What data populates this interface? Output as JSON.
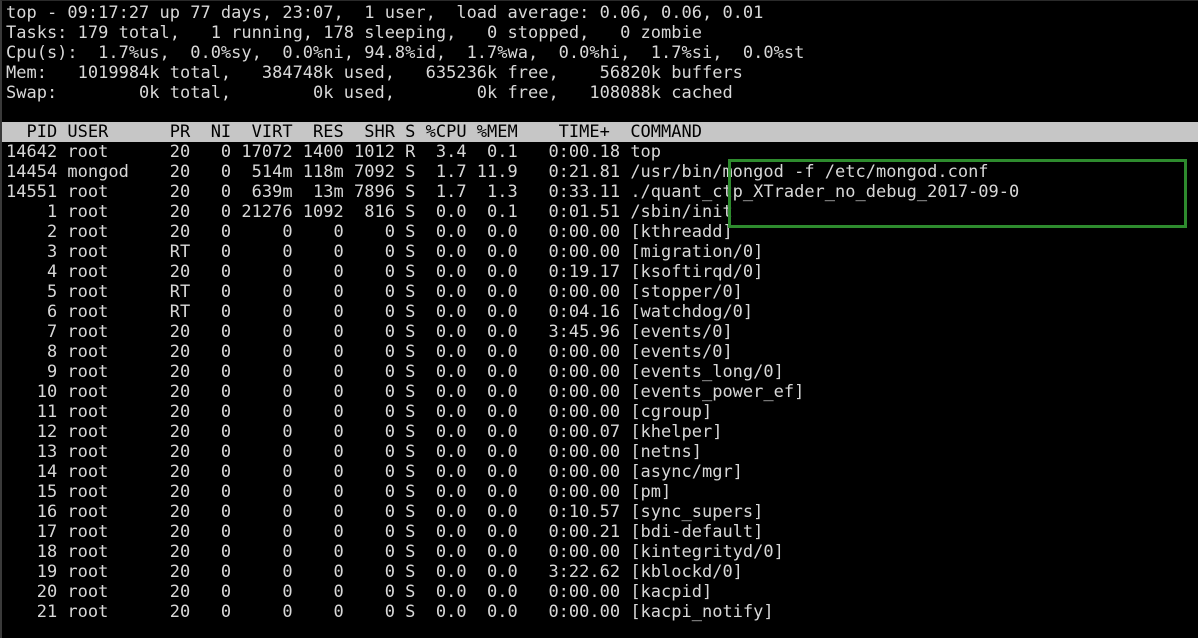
{
  "window": {
    "title": "top",
    "background": "#000000",
    "foreground": "#d8d8d8",
    "header_bg": "#c6c6c6",
    "header_fg": "#000000",
    "highlight_color": "#2e8b2e"
  },
  "summary": {
    "line1": "top - 09:17:27 up 77 days, 23:07,  1 user,  load average: 0.06, 0.06, 0.01",
    "line2": "Tasks: 179 total,   1 running, 178 sleeping,   0 stopped,   0 zombie",
    "line3": "Cpu(s):  1.7%us,  0.0%sy,  0.0%ni, 94.8%id,  1.7%wa,  0.0%hi,  1.7%si,  0.0%st",
    "line4": "Mem:   1019984k total,   384748k used,   635236k free,    56820k buffers",
    "line5": "Swap:        0k total,        0k used,        0k free,   108088k cached",
    "uptime_time": "09:17:27",
    "uptime_days": "77 days, 23:07",
    "users": "1 user",
    "load_average": [
      "0.06",
      "0.06",
      "0.01"
    ],
    "tasks": {
      "total": "179",
      "running": "1",
      "sleeping": "178",
      "stopped": "0",
      "zombie": "0"
    },
    "cpu": {
      "us": "1.7",
      "sy": "0.0",
      "ni": "0.0",
      "id": "94.8",
      "wa": "1.7",
      "hi": "0.0",
      "si": "1.7",
      "st": "0.0"
    },
    "mem": {
      "total": "1019984k",
      "used": "384748k",
      "free": "635236k",
      "buffers": "56820k"
    },
    "swap": {
      "total": "0k",
      "used": "0k",
      "free": "0k",
      "cached": "108088k"
    }
  },
  "table": {
    "header": "  PID USER      PR  NI  VIRT  RES  SHR S %CPU %MEM    TIME+  COMMAND",
    "columns": [
      "PID",
      "USER",
      "PR",
      "NI",
      "VIRT",
      "RES",
      "SHR",
      "S",
      "%CPU",
      "%MEM",
      "TIME+",
      "COMMAND"
    ],
    "rows": [
      "14642 root      20   0 17072 1400 1012 R  3.4  0.1   0:00.18 top",
      "14454 mongod    20   0  514m 118m 7092 S  1.7 11.9   0:21.81 /usr/bin/mongod -f /etc/mongod.conf",
      "14551 root      20   0  639m  13m 7896 S  1.7  1.3   0:33.11 ./quant_ctp_XTrader_no_debug_2017-09-0",
      "    1 root      20   0 21276 1092  816 S  0.0  0.1   0:01.51 /sbin/init",
      "    2 root      20   0     0    0    0 S  0.0  0.0   0:00.00 [kthreadd]",
      "    3 root      RT   0     0    0    0 S  0.0  0.0   0:00.00 [migration/0]",
      "    4 root      20   0     0    0    0 S  0.0  0.0   0:19.17 [ksoftirqd/0]",
      "    5 root      RT   0     0    0    0 S  0.0  0.0   0:00.00 [stopper/0]",
      "    6 root      RT   0     0    0    0 S  0.0  0.0   0:04.16 [watchdog/0]",
      "    7 root      20   0     0    0    0 S  0.0  0.0   3:45.96 [events/0]",
      "    8 root      20   0     0    0    0 S  0.0  0.0   0:00.00 [events/0]",
      "    9 root      20   0     0    0    0 S  0.0  0.0   0:00.00 [events_long/0]",
      "   10 root      20   0     0    0    0 S  0.0  0.0   0:00.00 [events_power_ef]",
      "   11 root      20   0     0    0    0 S  0.0  0.0   0:00.00 [cgroup]",
      "   12 root      20   0     0    0    0 S  0.0  0.0   0:00.07 [khelper]",
      "   13 root      20   0     0    0    0 S  0.0  0.0   0:00.00 [netns]",
      "   14 root      20   0     0    0    0 S  0.0  0.0   0:00.00 [async/mgr]",
      "   15 root      20   0     0    0    0 S  0.0  0.0   0:00.00 [pm]",
      "   16 root      20   0     0    0    0 S  0.0  0.0   0:10.57 [sync_supers]",
      "   17 root      20   0     0    0    0 S  0.0  0.0   0:00.21 [bdi-default]",
      "   18 root      20   0     0    0    0 S  0.0  0.0   0:00.00 [kintegrityd/0]",
      "   19 root      20   0     0    0    0 S  0.0  0.0   3:22.62 [kblockd/0]",
      "   20 root      20   0     0    0    0 S  0.0  0.0   0:00.00 [kacpid]",
      "   21 root      20   0     0    0    0 S  0.0  0.0   0:00.00 [kacpi_notify]"
    ],
    "row_data": [
      {
        "pid": "14642",
        "user": "root",
        "pr": "20",
        "ni": "0",
        "virt": "17072",
        "res": "1400",
        "shr": "1012",
        "s": "R",
        "cpu": "3.4",
        "mem": "0.1",
        "time": "0:00.18",
        "command": "top"
      },
      {
        "pid": "14454",
        "user": "mongod",
        "pr": "20",
        "ni": "0",
        "virt": "514m",
        "res": "118m",
        "shr": "7092",
        "s": "S",
        "cpu": "1.7",
        "mem": "11.9",
        "time": "0:21.81",
        "command": "/usr/bin/mongod -f /etc/mongod.conf"
      },
      {
        "pid": "14551",
        "user": "root",
        "pr": "20",
        "ni": "0",
        "virt": "639m",
        "res": "13m",
        "shr": "7896",
        "s": "S",
        "cpu": "1.7",
        "mem": "1.3",
        "time": "0:33.11",
        "command": "./quant_ctp_XTrader_no_debug_2017-09-0"
      },
      {
        "pid": "1",
        "user": "root",
        "pr": "20",
        "ni": "0",
        "virt": "21276",
        "res": "1092",
        "shr": "816",
        "s": "S",
        "cpu": "0.0",
        "mem": "0.1",
        "time": "0:01.51",
        "command": "/sbin/init"
      },
      {
        "pid": "2",
        "user": "root",
        "pr": "20",
        "ni": "0",
        "virt": "0",
        "res": "0",
        "shr": "0",
        "s": "S",
        "cpu": "0.0",
        "mem": "0.0",
        "time": "0:00.00",
        "command": "[kthreadd]"
      },
      {
        "pid": "3",
        "user": "root",
        "pr": "RT",
        "ni": "0",
        "virt": "0",
        "res": "0",
        "shr": "0",
        "s": "S",
        "cpu": "0.0",
        "mem": "0.0",
        "time": "0:00.00",
        "command": "[migration/0]"
      },
      {
        "pid": "4",
        "user": "root",
        "pr": "20",
        "ni": "0",
        "virt": "0",
        "res": "0",
        "shr": "0",
        "s": "S",
        "cpu": "0.0",
        "mem": "0.0",
        "time": "0:19.17",
        "command": "[ksoftirqd/0]"
      },
      {
        "pid": "5",
        "user": "root",
        "pr": "RT",
        "ni": "0",
        "virt": "0",
        "res": "0",
        "shr": "0",
        "s": "S",
        "cpu": "0.0",
        "mem": "0.0",
        "time": "0:00.00",
        "command": "[stopper/0]"
      },
      {
        "pid": "6",
        "user": "root",
        "pr": "RT",
        "ni": "0",
        "virt": "0",
        "res": "0",
        "shr": "0",
        "s": "S",
        "cpu": "0.0",
        "mem": "0.0",
        "time": "0:04.16",
        "command": "[watchdog/0]"
      },
      {
        "pid": "7",
        "user": "root",
        "pr": "20",
        "ni": "0",
        "virt": "0",
        "res": "0",
        "shr": "0",
        "s": "S",
        "cpu": "0.0",
        "mem": "0.0",
        "time": "3:45.96",
        "command": "[events/0]"
      },
      {
        "pid": "8",
        "user": "root",
        "pr": "20",
        "ni": "0",
        "virt": "0",
        "res": "0",
        "shr": "0",
        "s": "S",
        "cpu": "0.0",
        "mem": "0.0",
        "time": "0:00.00",
        "command": "[events/0]"
      },
      {
        "pid": "9",
        "user": "root",
        "pr": "20",
        "ni": "0",
        "virt": "0",
        "res": "0",
        "shr": "0",
        "s": "S",
        "cpu": "0.0",
        "mem": "0.0",
        "time": "0:00.00",
        "command": "[events_long/0]"
      },
      {
        "pid": "10",
        "user": "root",
        "pr": "20",
        "ni": "0",
        "virt": "0",
        "res": "0",
        "shr": "0",
        "s": "S",
        "cpu": "0.0",
        "mem": "0.0",
        "time": "0:00.00",
        "command": "[events_power_ef]"
      },
      {
        "pid": "11",
        "user": "root",
        "pr": "20",
        "ni": "0",
        "virt": "0",
        "res": "0",
        "shr": "0",
        "s": "S",
        "cpu": "0.0",
        "mem": "0.0",
        "time": "0:00.00",
        "command": "[cgroup]"
      },
      {
        "pid": "12",
        "user": "root",
        "pr": "20",
        "ni": "0",
        "virt": "0",
        "res": "0",
        "shr": "0",
        "s": "S",
        "cpu": "0.0",
        "mem": "0.0",
        "time": "0:00.07",
        "command": "[khelper]"
      },
      {
        "pid": "13",
        "user": "root",
        "pr": "20",
        "ni": "0",
        "virt": "0",
        "res": "0",
        "shr": "0",
        "s": "S",
        "cpu": "0.0",
        "mem": "0.0",
        "time": "0:00.00",
        "command": "[netns]"
      },
      {
        "pid": "14",
        "user": "root",
        "pr": "20",
        "ni": "0",
        "virt": "0",
        "res": "0",
        "shr": "0",
        "s": "S",
        "cpu": "0.0",
        "mem": "0.0",
        "time": "0:00.00",
        "command": "[async/mgr]"
      },
      {
        "pid": "15",
        "user": "root",
        "pr": "20",
        "ni": "0",
        "virt": "0",
        "res": "0",
        "shr": "0",
        "s": "S",
        "cpu": "0.0",
        "mem": "0.0",
        "time": "0:00.00",
        "command": "[pm]"
      },
      {
        "pid": "16",
        "user": "root",
        "pr": "20",
        "ni": "0",
        "virt": "0",
        "res": "0",
        "shr": "0",
        "s": "S",
        "cpu": "0.0",
        "mem": "0.0",
        "time": "0:10.57",
        "command": "[sync_supers]"
      },
      {
        "pid": "17",
        "user": "root",
        "pr": "20",
        "ni": "0",
        "virt": "0",
        "res": "0",
        "shr": "0",
        "s": "S",
        "cpu": "0.0",
        "mem": "0.0",
        "time": "0:00.21",
        "command": "[bdi-default]"
      },
      {
        "pid": "18",
        "user": "root",
        "pr": "20",
        "ni": "0",
        "virt": "0",
        "res": "0",
        "shr": "0",
        "s": "S",
        "cpu": "0.0",
        "mem": "0.0",
        "time": "0:00.00",
        "command": "[kintegrityd/0]"
      },
      {
        "pid": "19",
        "user": "root",
        "pr": "20",
        "ni": "0",
        "virt": "0",
        "res": "0",
        "shr": "0",
        "s": "S",
        "cpu": "0.0",
        "mem": "0.0",
        "time": "3:22.62",
        "command": "[kblockd/0]"
      },
      {
        "pid": "20",
        "user": "root",
        "pr": "20",
        "ni": "0",
        "virt": "0",
        "res": "0",
        "shr": "0",
        "s": "S",
        "cpu": "0.0",
        "mem": "0.0",
        "time": "0:00.00",
        "command": "[kacpid]"
      },
      {
        "pid": "21",
        "user": "root",
        "pr": "20",
        "ni": "0",
        "virt": "0",
        "res": "0",
        "shr": "0",
        "s": "S",
        "cpu": "0.0",
        "mem": "0.0",
        "time": "0:00.00",
        "command": "[kacpi_notify]"
      }
    ]
  },
  "annotation": {
    "type": "rectangle-highlight",
    "color": "#2e8b2e",
    "covers_rows": [
      "/usr/bin/mongod -f /etc/mongod.conf",
      "./quant_ctp_XTrader_no_debug_2017-09-0",
      "/sbin/init"
    ]
  }
}
